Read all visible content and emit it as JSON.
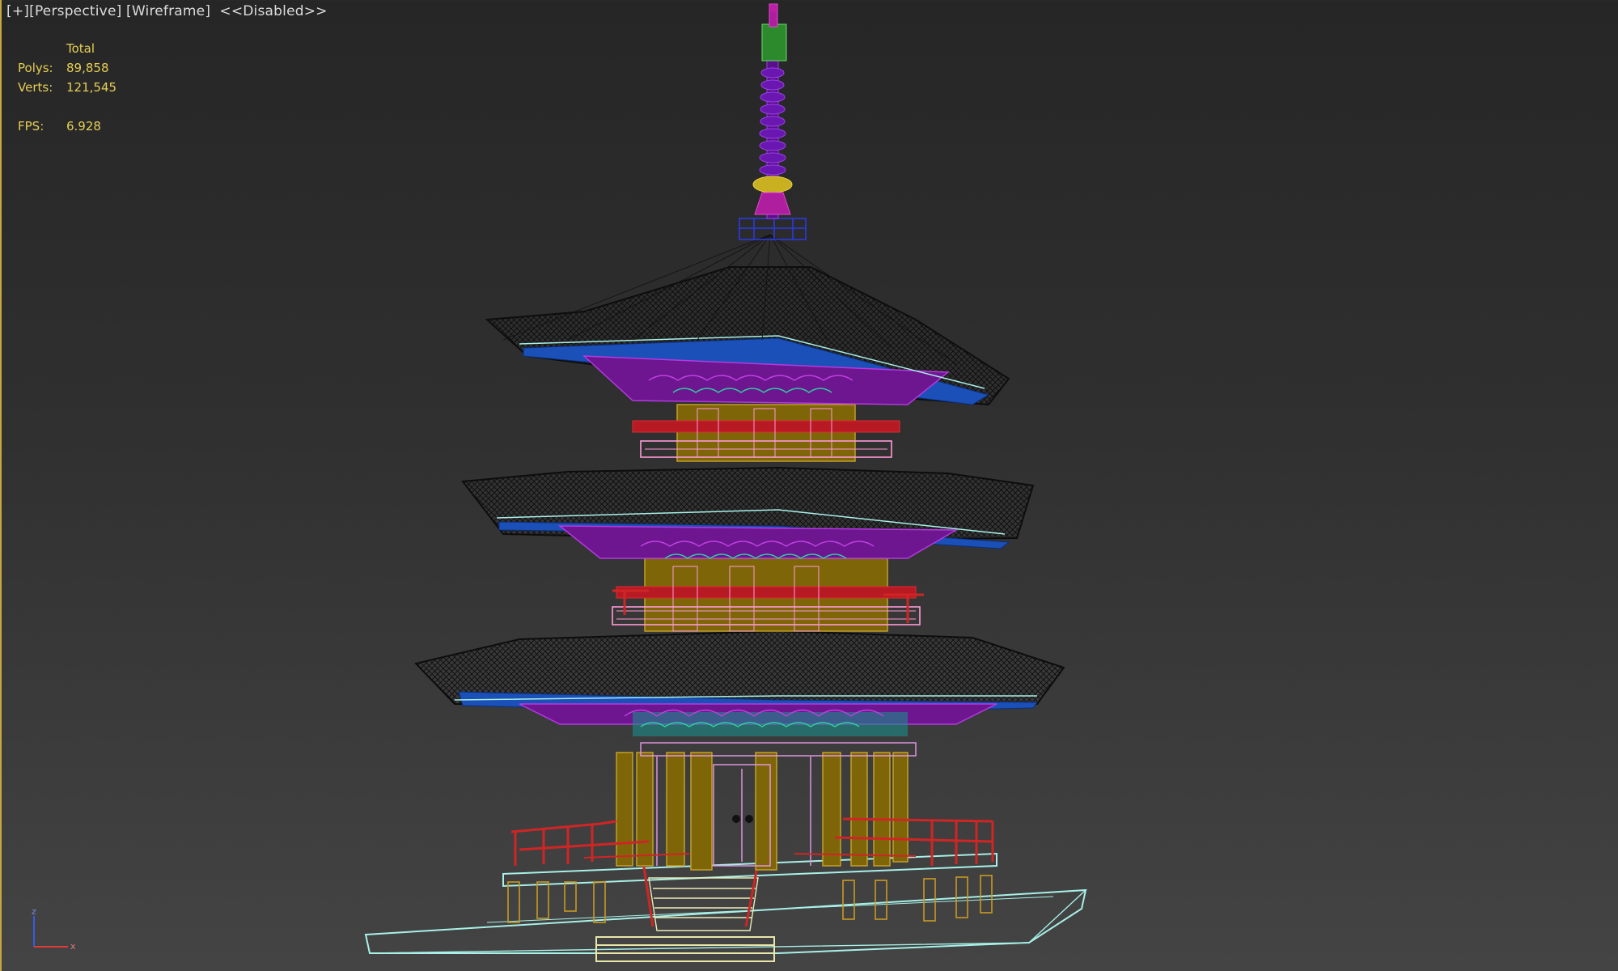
{
  "viewport": {
    "label_plus": "[+]",
    "label_view": "[Perspective]",
    "label_shading": "[Wireframe]",
    "label_disabled": "<<Disabled>>"
  },
  "stats": {
    "header": "Total",
    "polys_label": "Polys:",
    "polys_value": "89,858",
    "verts_label": "Verts:",
    "verts_value": "121,545",
    "fps_label": "FPS:",
    "fps_value": "6.928"
  },
  "axis": {
    "z": "z",
    "x": "x"
  },
  "colors": {
    "background_top": "#262626",
    "background_bottom": "#444444",
    "viewport_border": "#c9a83a",
    "stats_text": "#e6cf55",
    "roof_wire": "#111111",
    "roof_underside": "#1a50b8",
    "brackets": "#9a22c0",
    "beams": "#d81e2a",
    "columns": "#a88a10",
    "railing": "#d02525",
    "base": "#a8f0e8",
    "spire": "#7a1ab8",
    "finial": "#b01ea0",
    "spire_top": "#2c8a2c"
  }
}
